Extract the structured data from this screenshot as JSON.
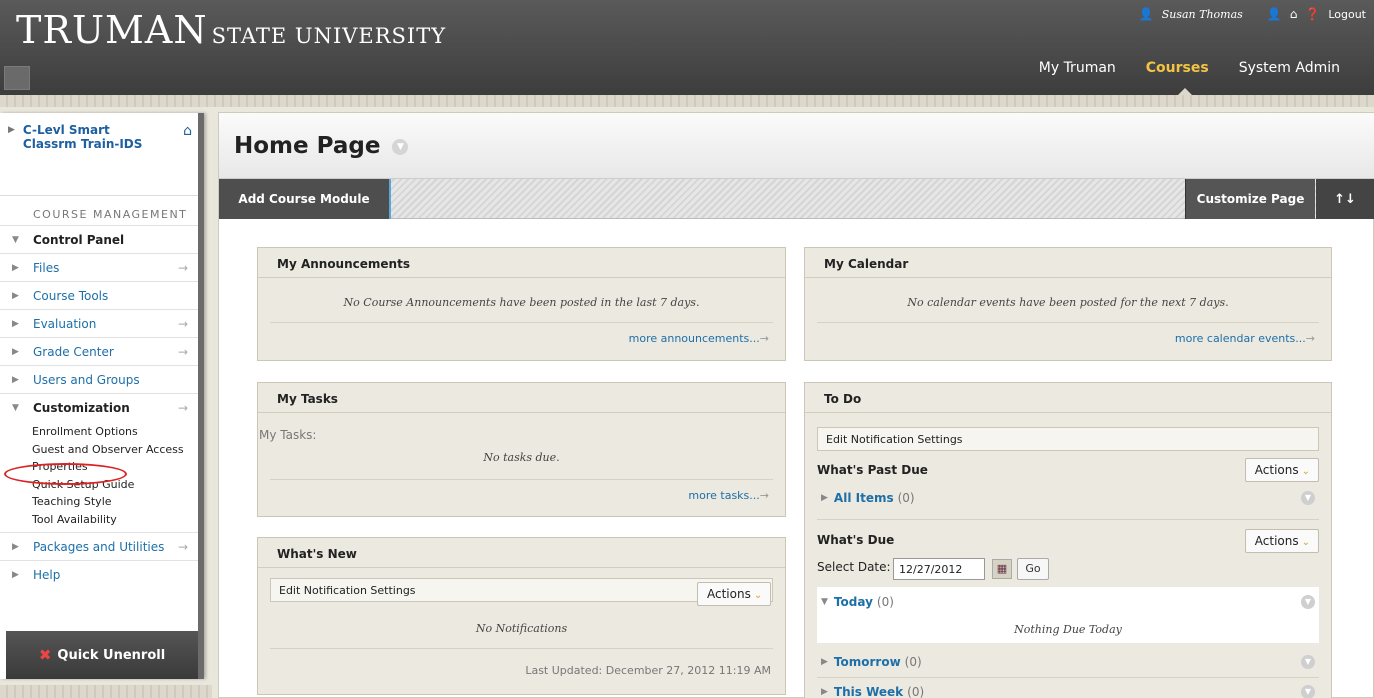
{
  "header": {
    "logo_main": "TRUMAN",
    "logo_sub": "STATE UNIVERSITY",
    "user_name": "Susan Thomas",
    "logout": "Logout",
    "nav": [
      "My Truman",
      "Courses",
      "System Admin"
    ],
    "active_nav": "Courses"
  },
  "sidebar": {
    "course_title": "C-Levl Smart Classrm Train-IDS",
    "section_heading": "COURSE MANAGEMENT",
    "control_panel": "Control Panel",
    "items": [
      {
        "label": "Files"
      },
      {
        "label": "Course Tools"
      },
      {
        "label": "Evaluation"
      },
      {
        "label": "Grade Center"
      },
      {
        "label": "Users and Groups"
      }
    ],
    "customization": "Customization",
    "customization_items": [
      "Enrollment Options",
      "Guest and Observer Access",
      "Properties",
      "Quick Setup Guide",
      "Teaching Style",
      "Tool Availability"
    ],
    "packages": "Packages and Utilities",
    "help": "Help",
    "quick_unenroll": "Quick Unenroll"
  },
  "main": {
    "title": "Home Page",
    "add_module": "Add Course Module",
    "customize": "Customize Page",
    "sort_icon": "↑↓"
  },
  "announcements": {
    "title": "My Announcements",
    "message": "No Course Announcements have been posted in the last 7 days.",
    "more": "more announcements..."
  },
  "calendar": {
    "title": "My Calendar",
    "message": "No calendar events have been posted for the next 7 days.",
    "more": "more calendar events..."
  },
  "tasks": {
    "title": "My Tasks",
    "label": "My Tasks:",
    "message": "No tasks due.",
    "more": "more tasks..."
  },
  "whats_new": {
    "title": "What's New",
    "edit": "Edit Notification Settings",
    "actions": "Actions",
    "message": "No Notifications",
    "updated": "Last Updated: December 27, 2012 11:19 AM"
  },
  "todo": {
    "title": "To Do",
    "edit": "Edit Notification Settings",
    "past_due": "What's Past Due",
    "actions": "Actions",
    "all_items": "All Items",
    "all_items_count": "(0)",
    "whats_due": "What's Due",
    "select_date_label": "Select Date:",
    "date": "12/27/2012",
    "go": "Go",
    "today": "Today",
    "today_count": "(0)",
    "nothing_due": "Nothing Due Today",
    "tomorrow": "Tomorrow",
    "tomorrow_count": "(0)",
    "this_week": "This Week",
    "this_week_count": "(0)"
  }
}
